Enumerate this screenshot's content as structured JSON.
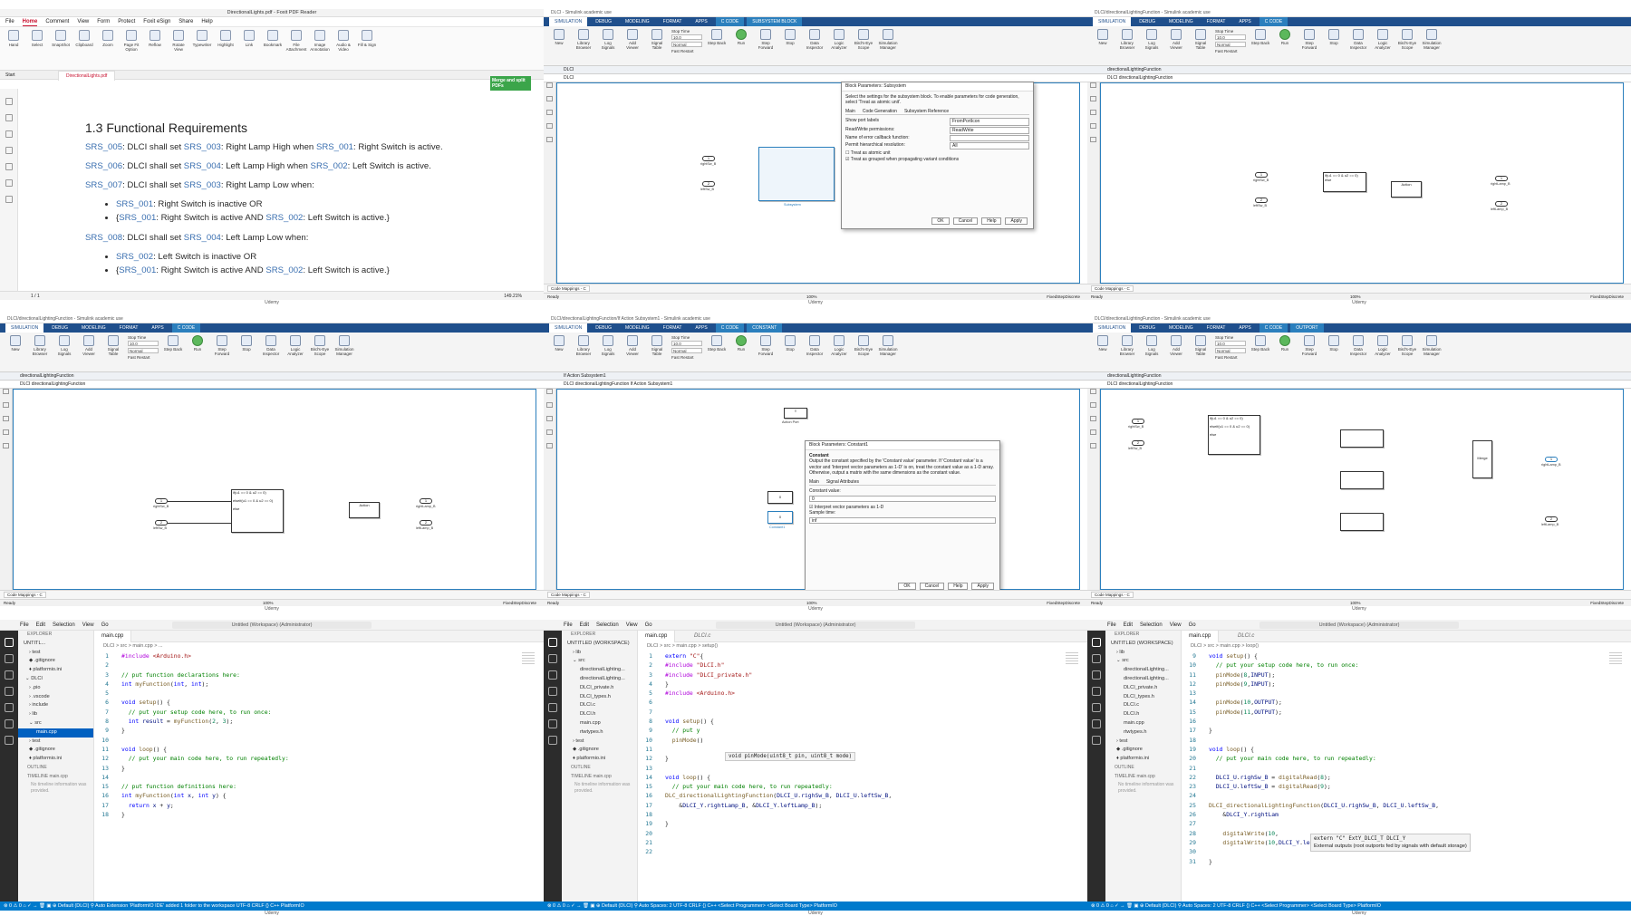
{
  "footer": "Udemy",
  "pdf": {
    "title": "DirectionalLights.pdf - Foxit PDF Reader",
    "menu": [
      "File",
      "Home",
      "Comment",
      "View",
      "Form",
      "Protect",
      "Foxit eSign",
      "Share",
      "Help"
    ],
    "active_menu": "Home",
    "search_placeholder": "Tell me...",
    "ribbon": [
      "Hand",
      "Select",
      "SnapShot",
      "Clipboard",
      "Zoom",
      "Page Fit Option",
      "Reflow",
      "Rotate View",
      "Typewriter",
      "Highlight",
      "Link",
      "Bookmark",
      "File Attachment",
      "Image Annotation",
      "Audio & Video",
      "Fill & Sign"
    ],
    "start_tab": "Start",
    "doc_tab": "DirectionalLights.pdf",
    "merge_banner": "Merge and split PDFs",
    "heading": "1.3 Functional Requirements",
    "req1": {
      "id": "SRS_005",
      "a": ": DLCI shall set ",
      "b": "SRS_003",
      "c": ": Right Lamp High when ",
      "d": "SRS_001",
      "e": ": Right Switch is active."
    },
    "req2": {
      "id": "SRS_006",
      "a": ": DLCI shall set ",
      "b": "SRS_004",
      "c": ": Left Lamp High when ",
      "d": "SRS_002",
      "e": ": Left Switch is active."
    },
    "req3": {
      "id": "SRS_007",
      "a": ": DLCI shall set ",
      "b": "SRS_003",
      "c": ": Right Lamp Low when:"
    },
    "req3_items": [
      {
        "a": "SRS_001",
        "b": ": Right Switch is inactive OR"
      },
      {
        "p": "{",
        "a": "SRS_001",
        "b": ": Right Switch is active AND ",
        "c": "SRS_002",
        "d": ": Left Switch is active.}"
      }
    ],
    "req4": {
      "id": "SRS_008",
      "a": ": DLCI shall set ",
      "b": "SRS_004",
      "c": ": Left Lamp Low when:"
    },
    "req4_items": [
      {
        "a": "SRS_002",
        "b": ": Left Switch is inactive OR"
      },
      {
        "p": "{",
        "a": "SRS_001",
        "b": ": Right Switch is active AND ",
        "c": "SRS_002",
        "d": ": Left Switch is active.}"
      }
    ],
    "page": "1 / 1",
    "zoom": "149.21%"
  },
  "sim": {
    "tabs": [
      "SIMULATION",
      "DEBUG",
      "MODELING",
      "FORMAT",
      "APPS"
    ],
    "tools": [
      "New",
      "Library Browser",
      "Log Signals",
      "Add Viewer",
      "Signal Table",
      "Step Back",
      "Run",
      "Step Forward",
      "Stop",
      "Data Inspector",
      "Logic Analyzer",
      "Bird's-Eye Scope",
      "Simulation Manager"
    ],
    "stop_time_label": "Stop Time",
    "stop_time": "10.0",
    "mode": "Normal",
    "fast_restart": "Fast Restart",
    "ready": "Ready",
    "percent": "100%",
    "solver": "FixedStepDiscrete",
    "code_mappings": "Code Mappings - C",
    "w1": {
      "title": "DLCI - Simulink academic use",
      "ctx1": "C CODE",
      "ctx2": "SUBSYSTEM BLOCK",
      "nav": "DLCI",
      "crumb": "DLCI",
      "in1": "rightSw_B",
      "in2": "leftSw_B",
      "sub_label": "Subsystem",
      "dlg": {
        "title": "Block Parameters: Subsystem",
        "desc": "Select the settings for the subsystem block. To enable parameters for code generation, select 'Treat as atomic unit'.",
        "tabs": [
          "Main",
          "Code Generation",
          "Subsystem Reference"
        ],
        "r1": "Show port labels",
        "r1v": "FromPortIcon",
        "r2": "Read/Write permissions:",
        "r2v": "ReadWrite",
        "r3": "Name of error callback function:",
        "r4": "Permit hierarchical resolution:",
        "r4v": "All",
        "c1": "Treat as atomic unit",
        "c2": "Treat as grouped when propagating variant conditions",
        "ok": "OK",
        "cancel": "Cancel",
        "help": "Help",
        "apply": "Apply"
      }
    },
    "w2": {
      "title": "DLCI/directionalLightingFunction - Simulink academic use",
      "ctx1": "C CODE",
      "nav": "directionalLightingFunction",
      "crumb": "DLCI  directionalLightingFunction",
      "in1": "rightSw_B",
      "in2": "leftSw_B",
      "out1": "rightLamp_B",
      "out2": "leftLamp_B",
      "if_u1": "if(u1 == 0 & u2 == 0)",
      "if_else": "else",
      "action": "Action"
    },
    "w3": {
      "title": "DLCI/directionalLightingFunction - Simulink academic use",
      "ctx1": "C CODE",
      "nav": "directionalLightingFunction",
      "crumb": "DLCI  directionalLightingFunction",
      "in1": "rightSw_B",
      "in2": "leftSw_B",
      "out1": "rightLamp_B",
      "out2": "leftLamp_B",
      "if1": "if(u1 == 0 & u2 == 0)",
      "if2": "elseif(u1 == 0 & u2 == 0)",
      "if_else": "else",
      "action": "Action"
    },
    "w4": {
      "title": "DLCI/directionalLightingFunction/If Action Subsystem1 - Simulink academic use",
      "ctx1": "C CODE",
      "ctx2": "CONSTANT",
      "nav": "If Action Subsystem1",
      "crumb": "DLCI  directionalLightingFunction  If Action Subsystem1",
      "action_port": "Action Port",
      "const0": "0",
      "const1": "0",
      "const_label": "Constant1",
      "dlg": {
        "title": "Block Parameters: Constant1",
        "sub": "Constant",
        "desc": "Output the constant specified by the 'Constant value' parameter. If 'Constant value' is a vector and 'Interpret vector parameters as 1-D' is on, treat the constant value as a 1-D array. Otherwise, output a matrix with the same dimensions as the constant value.",
        "tabs": [
          "Main",
          "Signal Attributes"
        ],
        "cv_label": "Constant value:",
        "cv": "0",
        "chk": "Interpret vector parameters as 1-D",
        "st_label": "Sample time:",
        "st": "inf",
        "ok": "OK",
        "cancel": "Cancel",
        "help": "Help",
        "apply": "Apply"
      }
    },
    "w5": {
      "title": "DLCI/directionalLightingFunction - Simulink academic use",
      "ctx1": "C CODE",
      "ctx2": "OUTPORT",
      "nav": "directionalLightingFunction",
      "crumb": "DLCI  directionalLightingFunction",
      "in1": "rightSw_B",
      "in2": "leftSw_B",
      "out1": "rightLamp_B",
      "out2": "leftLamp_B",
      "merge": "Merge",
      "if1": "if(u1 == 0 & u2 == 0)",
      "if2": "elseif(u1 == 0 & u2 == 0)",
      "if_else": "else"
    }
  },
  "vscode": {
    "menu": [
      "File",
      "Edit",
      "Selection",
      "View",
      "Go"
    ],
    "workspace": "Untitled (Workspace) (Administrator)",
    "explorer": "EXPLORER",
    "outline": "OUTLINE",
    "timeline": "TIMELINE",
    "timeline_file": "main.cpp",
    "no_timeline": "No timeline information was provided.",
    "status1": "⊗ 0 ⚠ 0   ⌂   ✓   →   🗑   ▣   ⊕ Default (DLCI)   ⚲ Auto   Extension 'PlatformIO IDE' added 1 folder to the workspace   UTF-8   CRLF   {} C++   PlatformIO",
    "status2": "⊗ 0 ⚠ 0   ⌂   ✓   →   🗑   ▣   ⊕ Default (DLCI)   ⚲ Auto   Spaces: 2   UTF-8   CRLF   {} C++   <Select Programmer>   <Select Board Type>   PlatformIO",
    "v1": {
      "tab": "main.cpp",
      "crumbs": "DLCI > src > main.cpp > ...",
      "tree": [
        {
          "t": "UNTITL...",
          "l": 6
        },
        {
          "t": "› test",
          "l": 12
        },
        {
          "t": "◆ .gitignore",
          "l": 12
        },
        {
          "t": "♦ platformio.ini",
          "l": 12
        },
        {
          "t": "⌄ DLCI",
          "l": 8
        },
        {
          "t": "› .pio",
          "l": 12
        },
        {
          "t": "› .vscode",
          "l": 12
        },
        {
          "t": "› include",
          "l": 12
        },
        {
          "t": "› lib",
          "l": 12
        },
        {
          "t": "⌄ src",
          "l": 12
        },
        {
          "t": "main.cpp",
          "l": 20,
          "sel": true
        },
        {
          "t": "› test",
          "l": 12
        },
        {
          "t": "◆ .gitignore",
          "l": 12
        },
        {
          "t": "♦ platformio.ini",
          "l": 12
        }
      ]
    },
    "v2": {
      "tab": "main.cpp",
      "tab2": "DLCI.c",
      "crumbs": "DLCI > src > main.cpp > setup()",
      "tree": [
        {
          "t": "UNTITLED (WORKSPACE)",
          "l": 6
        },
        {
          "t": "› lib",
          "l": 12
        },
        {
          "t": "⌄ src",
          "l": 12
        },
        {
          "t": "directionalLighting...",
          "l": 20
        },
        {
          "t": "directionalLighting...",
          "l": 20
        },
        {
          "t": "DLCI_private.h",
          "l": 20
        },
        {
          "t": "DLCI_types.h",
          "l": 20
        },
        {
          "t": "DLCI.c",
          "l": 20
        },
        {
          "t": "DLCI.h",
          "l": 20
        },
        {
          "t": "main.cpp",
          "l": 20
        },
        {
          "t": "rtwtypes.h",
          "l": 20
        },
        {
          "t": "› test",
          "l": 12
        },
        {
          "t": "◆ .gitignore",
          "l": 12
        },
        {
          "t": "♦ platformio.ini",
          "l": 12
        }
      ],
      "tooltip": "void pinMode(uint8_t pin, uint8_t mode)"
    },
    "v3": {
      "tab": "main.cpp",
      "tab2": "DLCI.c",
      "crumbs": "DLCI > src > main.cpp > loop()",
      "tree": [
        {
          "t": "UNTITLED (WORKSPACE)",
          "l": 6
        },
        {
          "t": "› lib",
          "l": 12
        },
        {
          "t": "⌄ src",
          "l": 12
        },
        {
          "t": "directionalLighting...",
          "l": 20
        },
        {
          "t": "directionalLighting...",
          "l": 20
        },
        {
          "t": "DLCI_private.h",
          "l": 20
        },
        {
          "t": "DLCI_types.h",
          "l": 20
        },
        {
          "t": "DLCI.c",
          "l": 20
        },
        {
          "t": "DLCI.h",
          "l": 20
        },
        {
          "t": "main.cpp",
          "l": 20
        },
        {
          "t": "rtwtypes.h",
          "l": 20
        },
        {
          "t": "› test",
          "l": 12
        },
        {
          "t": "◆ .gitignore",
          "l": 12
        },
        {
          "t": "♦ platformio.ini",
          "l": 12
        }
      ],
      "tooltip": "extern \"C\" ExtY_DLCI_T DLCI_Y",
      "tooltip2": "External outputs (root outports fed by signals with default storage)"
    }
  }
}
